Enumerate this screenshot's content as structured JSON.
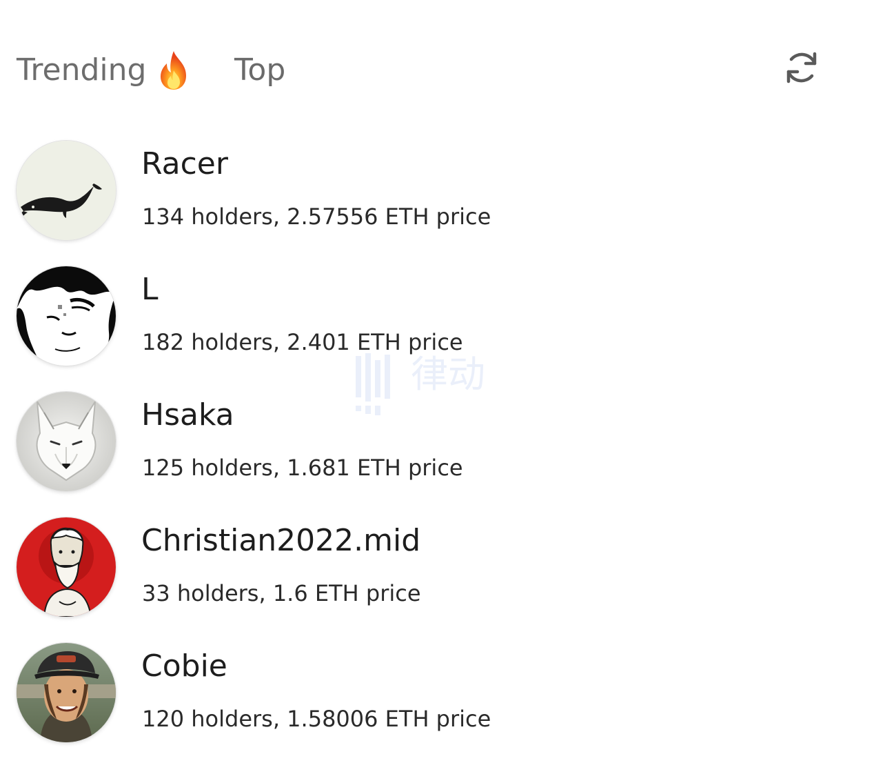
{
  "tabs": {
    "trending": {
      "label": "Trending",
      "icon": "fire-icon"
    },
    "top": {
      "label": "Top"
    },
    "refresh_icon": "refresh-icon"
  },
  "list": [
    {
      "name": "Racer",
      "meta": "134 holders, 2.57556 ETH price",
      "avatar": "koi-fish-ink-avatar"
    },
    {
      "name": "L",
      "meta": "182 holders, 2.401 ETH price",
      "avatar": "manga-face-avatar"
    },
    {
      "name": "Hsaka",
      "meta": "125 holders, 1.681 ETH price",
      "avatar": "white-wolf-avatar"
    },
    {
      "name": "Christian2022.mid",
      "meta": "33 holders, 1.6 ETH price",
      "avatar": "bearded-statue-red-avatar"
    },
    {
      "name": "Cobie",
      "meta": "120 holders, 1.58006 ETH price",
      "avatar": "man-in-cap-avatar"
    }
  ],
  "watermark": {
    "text": "律动"
  },
  "colors": {
    "tab_text": "#6d6d6d",
    "primary_text": "#1d1d1d",
    "christian_bg": "#d41e1e",
    "watermark": "#3a6fd8"
  }
}
